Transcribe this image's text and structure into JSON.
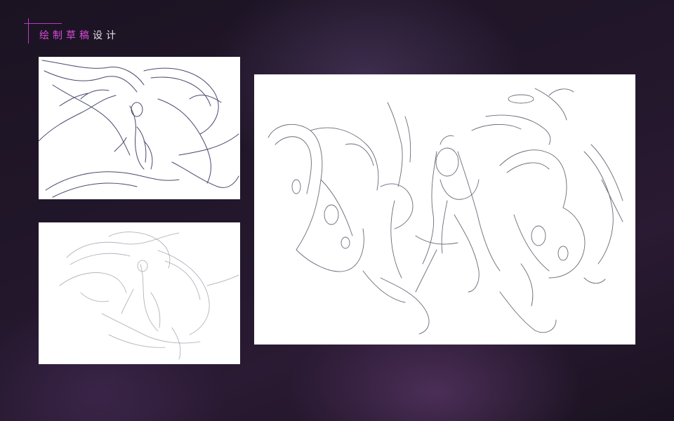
{
  "header": {
    "title_highlight": "绘制草稿",
    "title_rest": "设计"
  },
  "panels": [
    {
      "description_icon": "sketch-image"
    },
    {
      "description_icon": "sketch-image"
    },
    {
      "description_icon": "sketch-image"
    }
  ],
  "colors": {
    "accent": "#d64bd8",
    "background": "#22172b",
    "panel": "#ffffff"
  }
}
